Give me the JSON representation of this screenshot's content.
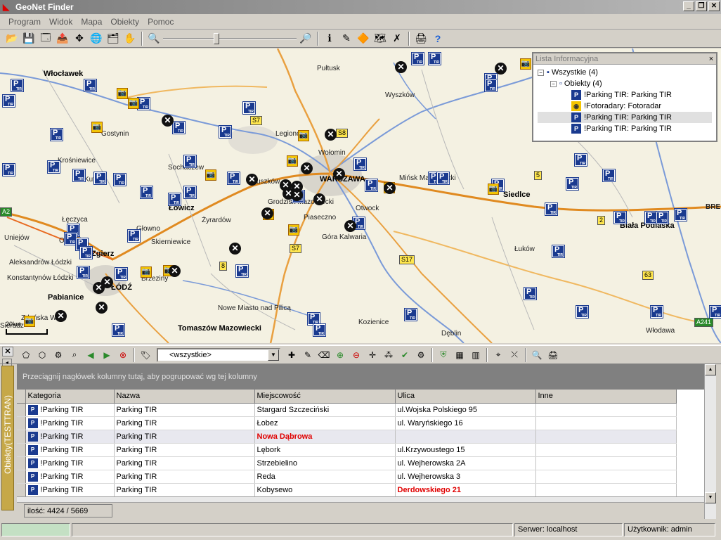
{
  "window": {
    "title": "GeoNet Finder"
  },
  "menu": [
    "Program",
    "Widok",
    "Mapa",
    "Obiekty",
    "Pomoc"
  ],
  "map": {
    "cities": [
      {
        "name": "Włocławek"
      },
      {
        "name": "WARSZAWA"
      },
      {
        "name": "ŁÓDŹ"
      },
      {
        "name": "Łowicz"
      },
      {
        "name": "Siedlce"
      },
      {
        "name": "Biała Podlaska"
      },
      {
        "name": "Tomaszów Mazowiecki"
      },
      {
        "name": "Pabianice"
      },
      {
        "name": "Zgierz"
      }
    ],
    "towns": [
      {
        "name": "Pułtusk"
      },
      {
        "name": "Wyszków"
      },
      {
        "name": "Gostynin"
      },
      {
        "name": "Krośniewice"
      },
      {
        "name": "Kutno"
      },
      {
        "name": "Sochaczew"
      },
      {
        "name": "Pruszków"
      },
      {
        "name": "Wołomin"
      },
      {
        "name": "Mińsk Mazowiecki"
      },
      {
        "name": "Grodzisk Mazowiecki"
      },
      {
        "name": "Otwock"
      },
      {
        "name": "Piaseczno"
      },
      {
        "name": "Góra Kalwaria"
      },
      {
        "name": "Żyrardów"
      },
      {
        "name": "Głowno"
      },
      {
        "name": "Skierniewice"
      },
      {
        "name": "Łęczyca"
      },
      {
        "name": "Uniejów"
      },
      {
        "name": "Ozorków"
      },
      {
        "name": "Aleksandrów Łódzki"
      },
      {
        "name": "Konstantynów Łódzki"
      },
      {
        "name": "Brzeziny"
      },
      {
        "name": "Łuków"
      },
      {
        "name": "Nowe Miasto nad Pilicą"
      },
      {
        "name": "Kozienice"
      },
      {
        "name": "Dęblin"
      },
      {
        "name": "Włodawa"
      },
      {
        "name": "Legionowo"
      },
      {
        "name": "BRE"
      },
      {
        "name": "Zduńska Wola"
      },
      {
        "name": "Sieradz"
      }
    ],
    "roads": [
      "S7",
      "S8",
      "A2",
      "S17",
      "63",
      "A241",
      "2",
      "5",
      "8",
      "S7"
    ],
    "scale": "20km"
  },
  "info_panel": {
    "title": "Lista Informacyjna",
    "root": "Wszystkie (4)",
    "group": "Obiekty (4)",
    "items": [
      "!Parking TIR: Parking TIR",
      "!Fotoradary: Fotoradar",
      "!Parking TIR: Parking TIR",
      "!Parking TIR: Parking TIR"
    ]
  },
  "filter": {
    "value": "<wszystkie>"
  },
  "side_tab": "Obiekty(TESTTRAN)",
  "group_hint": "Przeciągnij nagłówek kolumny tutaj, aby pogrupować wg tej kolumny",
  "table": {
    "columns": [
      "Kategoria",
      "Nazwa",
      "Miejscowość",
      "Ulica",
      "Inne"
    ],
    "rows": [
      {
        "kategoria": "!Parking TIR",
        "nazwa": "Parking TIR",
        "miejscowosc": "Stargard Szczeciński",
        "ulica": "ul.Wojska Polskiego 95",
        "inne": ""
      },
      {
        "kategoria": "!Parking TIR",
        "nazwa": "Parking TIR",
        "miejscowosc": "Łobez",
        "ulica": "ul. Waryńskiego 16",
        "inne": ""
      },
      {
        "kategoria": "!Parking TIR",
        "nazwa": "Parking TIR",
        "miejscowosc": "Nowa Dąbrowa",
        "ulica": "",
        "inne": ""
      },
      {
        "kategoria": "!Parking TIR",
        "nazwa": "Parking TIR",
        "miejscowosc": "Lębork",
        "ulica": "ul.Krzywoustego 15",
        "inne": ""
      },
      {
        "kategoria": "!Parking TIR",
        "nazwa": "Parking TIR",
        "miejscowosc": "Strzebielino",
        "ulica": "ul. Wejherowska 2A",
        "inne": ""
      },
      {
        "kategoria": "!Parking TIR",
        "nazwa": "Parking TIR",
        "miejscowosc": "Reda",
        "ulica": "ul. Wejherowska 3",
        "inne": ""
      },
      {
        "kategoria": "!Parking TIR",
        "nazwa": "Parking TIR",
        "miejscowosc": "Kobysewo",
        "ulica": "Derdowskiego 21",
        "inne": ""
      }
    ]
  },
  "count": "ilość: 4424 / 5669",
  "status": {
    "server": "Serwer: localhost",
    "user": "Użytkownik: admin"
  }
}
